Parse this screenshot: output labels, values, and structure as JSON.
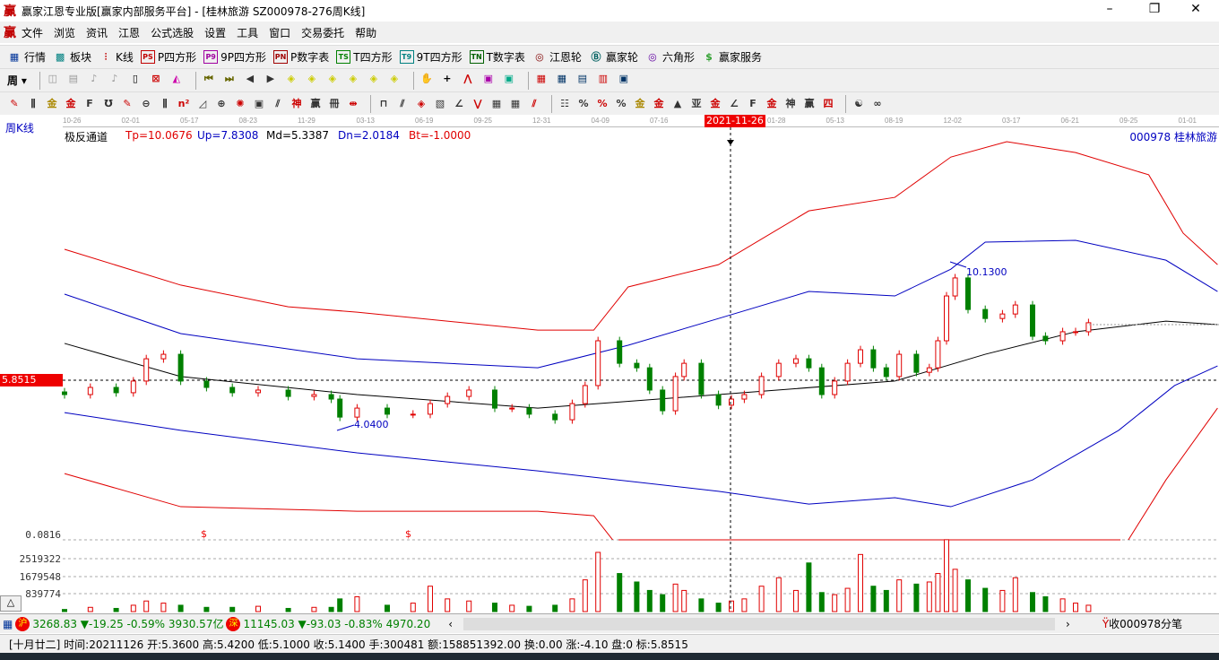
{
  "window": {
    "title": "赢家江恩专业版[赢家内部服务平台] - [桂林旅游  SZ000978-276周K线]",
    "logo": "赢",
    "minimize": "–",
    "maximize": "❐",
    "close": "✕"
  },
  "menu": [
    "文件",
    "浏览",
    "资讯",
    "江恩",
    "公式选股",
    "设置",
    "工具",
    "窗口",
    "交易委托",
    "帮助"
  ],
  "toolbar1": [
    {
      "icon": "grid-icon",
      "glyph": "▦",
      "label": "行情",
      "color": "#003399"
    },
    {
      "icon": "blocks-icon",
      "glyph": "▩",
      "label": "板块",
      "color": "#008080"
    },
    {
      "icon": "candles-icon",
      "glyph": "⫶",
      "label": "K线",
      "color": "#c00000"
    },
    {
      "icon": "ps-icon",
      "glyph": "PS",
      "label": "P四方形",
      "color": "#c00000",
      "box": true
    },
    {
      "icon": "p9-icon",
      "glyph": "P9",
      "label": "9P四方形",
      "color": "#a000a0",
      "box": true
    },
    {
      "icon": "pn-icon",
      "glyph": "PN",
      "label": "P数字表",
      "color": "#a00000",
      "box": true
    },
    {
      "icon": "ts-icon",
      "glyph": "TS",
      "label": "T四方形",
      "color": "#008000",
      "box": true
    },
    {
      "icon": "t9-icon",
      "glyph": "T9",
      "label": "9T四方形",
      "color": "#008080",
      "box": true
    },
    {
      "icon": "tn-icon",
      "glyph": "TN",
      "label": "T数字表",
      "color": "#006000",
      "box": true
    },
    {
      "icon": "wheel-icon",
      "glyph": "◎",
      "label": "江恩轮",
      "color": "#800000"
    },
    {
      "icon": "big-wheel-icon",
      "glyph": "Ⓑ",
      "label": "赢家轮",
      "color": "#006060"
    },
    {
      "icon": "hexagon-icon",
      "glyph": "◎",
      "label": "六角形",
      "color": "#6000a0"
    },
    {
      "icon": "dollar-icon",
      "glyph": "$",
      "label": "赢家服务",
      "color": "#30a030"
    }
  ],
  "toolbar2": {
    "period": "周",
    "icons": [
      "◫",
      "▤",
      "♪",
      "♪",
      "▯",
      "⊠",
      "◭",
      "⏮",
      "⏭",
      "◀",
      "▶",
      "◈",
      "◈",
      "◈",
      "◈",
      "◈",
      "◈",
      "✋",
      "+",
      "⋀",
      "▣",
      "▣",
      "▦",
      "▦",
      "▤",
      "▥",
      "▣"
    ]
  },
  "toolbar3": {
    "icons": [
      "✎",
      "⫼",
      "金",
      "金",
      "F",
      "℧",
      "✎",
      "⊖",
      "⫼",
      "n²",
      "◿",
      "⊕",
      "✺",
      "▣",
      "⫽",
      "神",
      "赢",
      "冊",
      "⇹",
      "⊓",
      "⫽",
      "◈",
      "▧",
      "∠",
      "⋁",
      "▦",
      "▦",
      "⫽",
      "☷",
      "%",
      "%",
      "%",
      "金",
      "金",
      "▲",
      "亚",
      "金",
      "∠",
      "F",
      "金",
      "神",
      "赢",
      "四",
      "☯",
      "∞"
    ]
  },
  "chart": {
    "period_label": "周K线",
    "indicator": {
      "name": "极反通道",
      "tp": "Tp=10.0676",
      "up": "Up=7.8308",
      "md": "Md=5.3387",
      "dn": "Dn=2.0184",
      "bt": "Bt=-1.0000"
    },
    "stock": "000978  桂林旅游",
    "cursor_date": "2021-11-26",
    "cursor_price": "5.8515",
    "date_ticks": [
      "10-26",
      "02-01",
      "05-17",
      "08-23",
      "11-29",
      "03-13",
      "06-19",
      "09-25",
      "12-31",
      "04-09",
      "07-16",
      "",
      "01-28",
      "05-13",
      "08-19",
      "12-02",
      "03-17",
      "06-21",
      "09-25",
      "01-01"
    ],
    "high_label": "10.1300",
    "low_label": "4.0400",
    "volume_axis": [
      "0.0816",
      "2519322",
      "1679548",
      "839774"
    ],
    "dollar_marker": "$",
    "colors": {
      "up": "#e00000",
      "down": "#008000",
      "band_outer": "#e00000",
      "band_inner": "#0000c0",
      "mid": "#000000"
    }
  },
  "chart_data": {
    "type": "candlestick",
    "x_unit": "week index",
    "candles_close": [
      [
        0,
        5.31
      ],
      [
        6,
        5.58
      ],
      [
        12,
        5.38
      ],
      [
        16,
        5.82
      ],
      [
        19,
        6.66
      ],
      [
        23,
        6.83
      ],
      [
        27,
        5.82
      ],
      [
        33,
        5.58
      ],
      [
        39,
        5.38
      ],
      [
        45,
        5.48
      ],
      [
        52,
        5.24
      ],
      [
        58,
        5.31
      ],
      [
        62,
        5.14
      ],
      [
        64,
        4.46
      ],
      [
        68,
        4.8
      ],
      [
        75,
        4.57
      ],
      [
        81,
        4.57
      ],
      [
        85,
        4.97
      ],
      [
        89,
        5.24
      ],
      [
        94,
        5.48
      ],
      [
        100,
        4.8
      ],
      [
        104,
        4.8
      ],
      [
        108,
        4.57
      ],
      [
        114,
        4.36
      ],
      [
        118,
        4.97
      ],
      [
        121,
        5.65
      ],
      [
        124,
        7.34
      ],
      [
        129,
        6.49
      ],
      [
        133,
        6.32
      ],
      [
        136,
        5.48
      ],
      [
        139,
        4.7
      ],
      [
        142,
        5.99
      ],
      [
        144,
        6.49
      ],
      [
        148,
        5.31
      ],
      [
        152,
        4.91
      ],
      [
        155,
        5.14
      ],
      [
        158,
        5.31
      ],
      [
        162,
        5.99
      ],
      [
        166,
        6.49
      ],
      [
        170,
        6.66
      ],
      [
        173,
        6.32
      ],
      [
        176,
        5.31
      ],
      [
        179,
        5.82
      ],
      [
        182,
        6.49
      ],
      [
        185,
        7.0
      ],
      [
        188,
        6.32
      ],
      [
        191,
        5.99
      ],
      [
        194,
        6.83
      ],
      [
        198,
        6.15
      ],
      [
        201,
        6.32
      ],
      [
        203,
        7.34
      ],
      [
        205,
        9.03
      ],
      [
        207,
        9.71
      ],
      [
        210,
        8.52
      ],
      [
        214,
        8.18
      ],
      [
        218,
        8.35
      ],
      [
        221,
        8.69
      ],
      [
        225,
        7.51
      ],
      [
        228,
        7.34
      ],
      [
        232,
        7.68
      ],
      [
        235,
        7.68
      ],
      [
        238,
        8.02
      ]
    ],
    "volume_millions": [
      0.1,
      0.2,
      0.15,
      0.3,
      0.5,
      0.4,
      0.3,
      0.2,
      0.2,
      0.25,
      0.15,
      0.2,
      0.2,
      0.6,
      0.7,
      0.3,
      0.4,
      1.2,
      0.6,
      0.5,
      0.4,
      0.3,
      0.25,
      0.3,
      0.6,
      1.5,
      2.8,
      1.8,
      1.4,
      1.0,
      0.8,
      1.3,
      1.0,
      0.6,
      0.4,
      0.5,
      0.6,
      1.2,
      1.6,
      1.0,
      2.3,
      0.9,
      0.8,
      1.1,
      2.7,
      1.2,
      1.0,
      1.5,
      1.3,
      1.4,
      1.8,
      3.4,
      2.0,
      1.5,
      1.1,
      1.0,
      1.6,
      0.9,
      0.7,
      0.6,
      0.4,
      0.3
    ],
    "mid": [
      [
        0,
        7.24
      ],
      [
        27,
        5.99
      ],
      [
        68,
        5.31
      ],
      [
        110,
        4.8
      ],
      [
        152,
        5.31
      ],
      [
        193,
        5.82
      ],
      [
        214,
        6.83
      ],
      [
        235,
        7.68
      ],
      [
        256,
        8.08
      ],
      [
        268,
        7.95
      ]
    ],
    "upper_inner": [
      [
        0,
        9.1
      ],
      [
        27,
        7.61
      ],
      [
        68,
        6.66
      ],
      [
        110,
        6.32
      ],
      [
        131,
        7.17
      ],
      [
        152,
        8.18
      ],
      [
        173,
        9.2
      ],
      [
        193,
        9.03
      ],
      [
        206,
        10.04
      ],
      [
        214,
        11.06
      ],
      [
        235,
        11.13
      ],
      [
        256,
        10.38
      ],
      [
        268,
        9.2
      ]
    ],
    "lower_inner": [
      [
        0,
        4.63
      ],
      [
        27,
        3.96
      ],
      [
        68,
        3.11
      ],
      [
        110,
        2.43
      ],
      [
        152,
        1.66
      ],
      [
        173,
        1.18
      ],
      [
        193,
        1.42
      ],
      [
        206,
        1.08
      ],
      [
        225,
        2.09
      ],
      [
        245,
        3.96
      ],
      [
        258,
        5.65
      ],
      [
        268,
        6.39
      ]
    ],
    "upper_outer": [
      [
        0,
        10.79
      ],
      [
        27,
        9.44
      ],
      [
        52,
        8.62
      ],
      [
        68,
        8.42
      ],
      [
        110,
        7.74
      ],
      [
        123,
        7.74
      ],
      [
        131,
        9.37
      ],
      [
        152,
        10.21
      ],
      [
        173,
        12.24
      ],
      [
        193,
        12.75
      ],
      [
        206,
        14.27
      ],
      [
        219,
        14.85
      ],
      [
        235,
        14.44
      ],
      [
        252,
        13.6
      ],
      [
        260,
        11.4
      ],
      [
        268,
        10.21
      ]
    ],
    "lower_outer": [
      [
        0,
        2.33
      ],
      [
        27,
        1.08
      ],
      [
        68,
        0.91
      ],
      [
        110,
        0.91
      ],
      [
        123,
        0.74
      ],
      [
        129,
        -0.5
      ],
      [
        152,
        -0.5
      ],
      [
        246,
        -0.5
      ],
      [
        256,
        2.09
      ],
      [
        268,
        4.8
      ]
    ]
  },
  "statusbar": {
    "sh": {
      "badge": "沪",
      "value": "3268.83",
      "change": "▼-19.25",
      "pct": "-0.59%",
      "amount": "3930.57亿"
    },
    "sz": {
      "badge": "深",
      "value": "11145.03",
      "change": "▼-93.03",
      "pct": "-0.83%",
      "amount": "4970.20"
    },
    "scroll_left": "‹",
    "scroll_right": "›",
    "receive": "收000978分笔"
  },
  "infobar": "[十月廿二] 时间:20211126 开:5.3600 高:5.4200 低:5.1000 收:5.1400 手:300481 额:158851392.00 换:0.00 涨:-4.10 盘:0 标:5.8515",
  "collapse_btn": "△"
}
